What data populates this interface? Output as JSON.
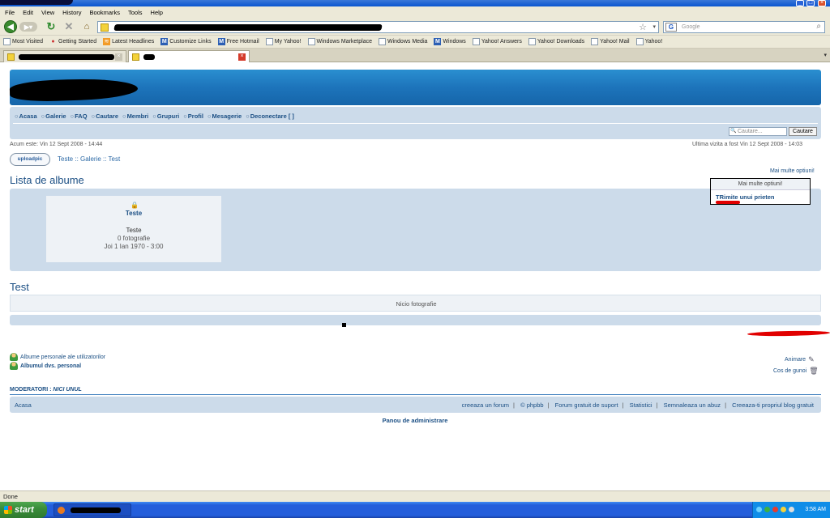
{
  "browser": {
    "menu": [
      "File",
      "Edit",
      "View",
      "History",
      "Bookmarks",
      "Tools",
      "Help"
    ],
    "search_placeholder": "Google",
    "bookmarks": [
      {
        "label": "Most Visited",
        "icon": "page-icon"
      },
      {
        "label": "Getting Started",
        "icon": "star-icon"
      },
      {
        "label": "Latest Headlines",
        "icon": "rss-icon"
      },
      {
        "label": "Customize Links",
        "icon": "msn-icon"
      },
      {
        "label": "Free Hotmail",
        "icon": "msn-icon"
      },
      {
        "label": "My Yahoo!",
        "icon": "page-icon"
      },
      {
        "label": "Windows Marketplace",
        "icon": "page-icon"
      },
      {
        "label": "Windows Media",
        "icon": "page-icon"
      },
      {
        "label": "Windows",
        "icon": "msn-icon"
      },
      {
        "label": "Yahoo! Answers",
        "icon": "page-icon"
      },
      {
        "label": "Yahoo! Downloads",
        "icon": "page-icon"
      },
      {
        "label": "Yahoo! Mail",
        "icon": "page-icon"
      },
      {
        "label": "Yahoo!",
        "icon": "page-icon"
      }
    ],
    "status": "Done"
  },
  "forum": {
    "nav": [
      "Acasa",
      "Galerie",
      "FAQ",
      "Cautare",
      "Membri",
      "Grupuri",
      "Profil",
      "Mesagerie",
      "Deconectare [ ]"
    ],
    "search_placeholder": "Cautare...",
    "search_button": "Cautare",
    "current_time": "Acum este: Vin 12 Sept 2008 - 14:44",
    "last_visit": "Ultima vizita a fost Vin 12 Sept 2008 - 14:03",
    "upload_label": "uploadpic",
    "breadcrumb": "Teste :: Galerie :: Test",
    "page_title": "Lista de albume",
    "more_options": "Mai multe optiuni!",
    "popup": {
      "title": "Mai multe optiuni!",
      "item": "TRimite unui prieten"
    },
    "album": {
      "link": "Teste",
      "name": "Teste",
      "count": "0 fotografie",
      "date": "Joi 1 Ian 1970 - 3:00"
    },
    "section_title": "Test",
    "no_photo": "Nicio fotografie",
    "personal_albums": "Albume personale ale utilizatorilor",
    "my_album": "Albumul dvs. personal",
    "animare": "Animare",
    "trash": "Cos de gunoi",
    "moderators_label": "MODERATORI :",
    "moderators_value": "NICI UNUL",
    "footer_home": "Acasa",
    "footer_links": [
      "creeaza un forum",
      "©  phpbb",
      "Forum gratuit de suport",
      "Statistici",
      "Semnaleaza un abuz",
      "Creeaza-ti propriul blog gratuit"
    ],
    "admin_panel": "Panou de administrare"
  },
  "taskbar": {
    "start": "start",
    "clock": "3:58 AM"
  }
}
